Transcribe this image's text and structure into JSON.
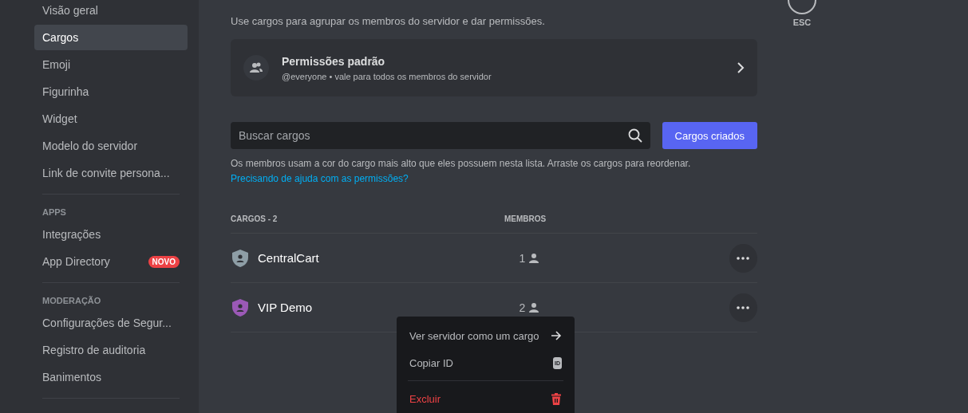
{
  "sidebar": {
    "items": [
      {
        "kind": "item",
        "label": "Visão geral",
        "selected": false
      },
      {
        "kind": "item",
        "label": "Cargos",
        "selected": true
      },
      {
        "kind": "item",
        "label": "Emoji",
        "selected": false
      },
      {
        "kind": "item",
        "label": "Figurinha",
        "selected": false
      },
      {
        "kind": "item",
        "label": "Widget",
        "selected": false
      },
      {
        "kind": "item",
        "label": "Modelo do servidor",
        "selected": false
      },
      {
        "kind": "item",
        "label": "Link de convite persona...",
        "selected": false
      },
      {
        "kind": "divider"
      },
      {
        "kind": "header",
        "label": "APPS"
      },
      {
        "kind": "item",
        "label": "Integrações",
        "selected": false
      },
      {
        "kind": "item",
        "label": "App Directory",
        "selected": false,
        "badge": "NOVO"
      },
      {
        "kind": "divider"
      },
      {
        "kind": "header",
        "label": "MODERAÇÃO"
      },
      {
        "kind": "item",
        "label": "Configurações de Segur...",
        "selected": false
      },
      {
        "kind": "item",
        "label": "Registro de auditoria",
        "selected": false
      },
      {
        "kind": "item",
        "label": "Banimentos",
        "selected": false
      },
      {
        "kind": "divider"
      }
    ]
  },
  "description": "Use cargos para agrupar os membros do servidor e dar permissões.",
  "default_permissions": {
    "title": "Permissões padrão",
    "subtitle": "@everyone • vale para todos os membros do servidor"
  },
  "search": {
    "placeholder": "Buscar cargos"
  },
  "create_button": "Cargos criados",
  "help_text": "Os membros usam a cor do cargo mais alto que eles possuem nesta lista. Arraste os cargos para reordenar.",
  "help_link": "Precisando de ajuda com as permissões?",
  "table": {
    "columns": [
      "CARGOS - 2",
      "MEMBROS"
    ],
    "rows": [
      {
        "name": "CentralCart",
        "members": "1",
        "color": "#8e9ea6"
      },
      {
        "name": "VIP Demo",
        "members": "2",
        "color": "#9b59b6"
      }
    ]
  },
  "context_menu": {
    "items": [
      {
        "kind": "arrow",
        "label": "Ver servidor como um cargo"
      },
      {
        "kind": "id",
        "label": "Copiar ID",
        "icon_text": "ID"
      },
      {
        "kind": "danger",
        "label": "Excluir"
      }
    ]
  },
  "close": {
    "label": "ESC"
  }
}
